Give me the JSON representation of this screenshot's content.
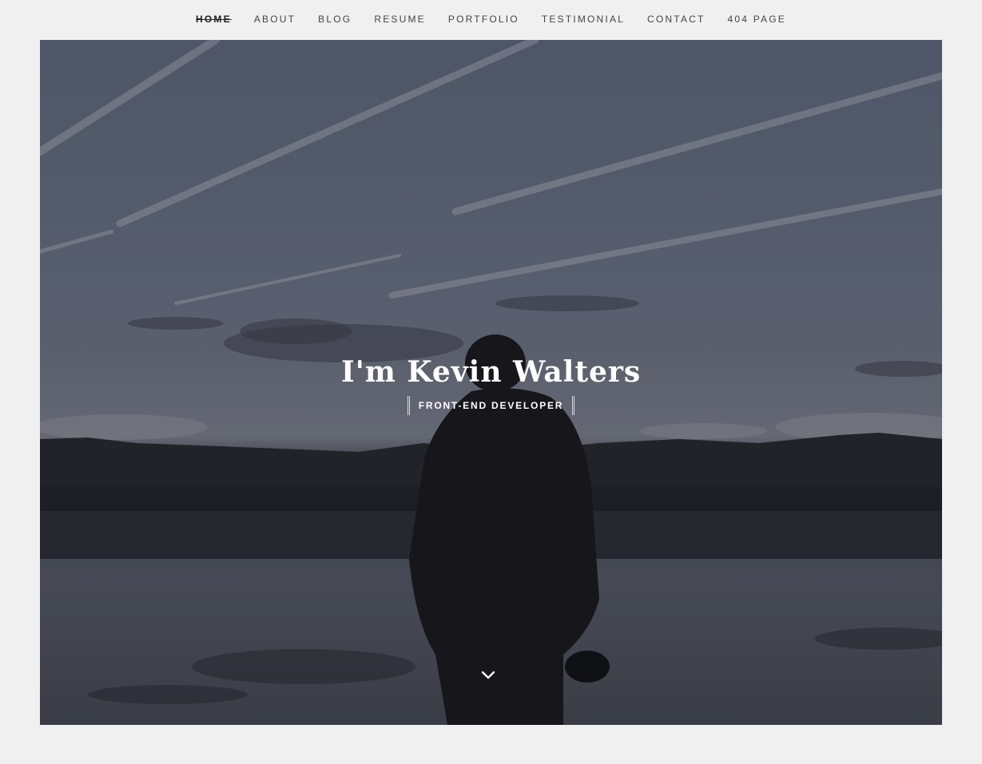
{
  "nav": {
    "items": [
      {
        "label": "HOME",
        "active": true
      },
      {
        "label": "ABOUT",
        "active": false
      },
      {
        "label": "BLOG",
        "active": false
      },
      {
        "label": "RESUME",
        "active": false
      },
      {
        "label": "PORTFOLIO",
        "active": false
      },
      {
        "label": "TESTIMONIAL",
        "active": false
      },
      {
        "label": "CONTACT",
        "active": false
      },
      {
        "label": "404 PAGE",
        "active": false
      }
    ]
  },
  "hero": {
    "title": "I'm Kevin Walters",
    "subtitle": "FRONT-END DEVELOPER",
    "scroll_icon": "chevron-down-icon"
  },
  "colors": {
    "background": "#f0f0f0",
    "nav_text": "#444444",
    "hero_text": "#ffffff"
  }
}
